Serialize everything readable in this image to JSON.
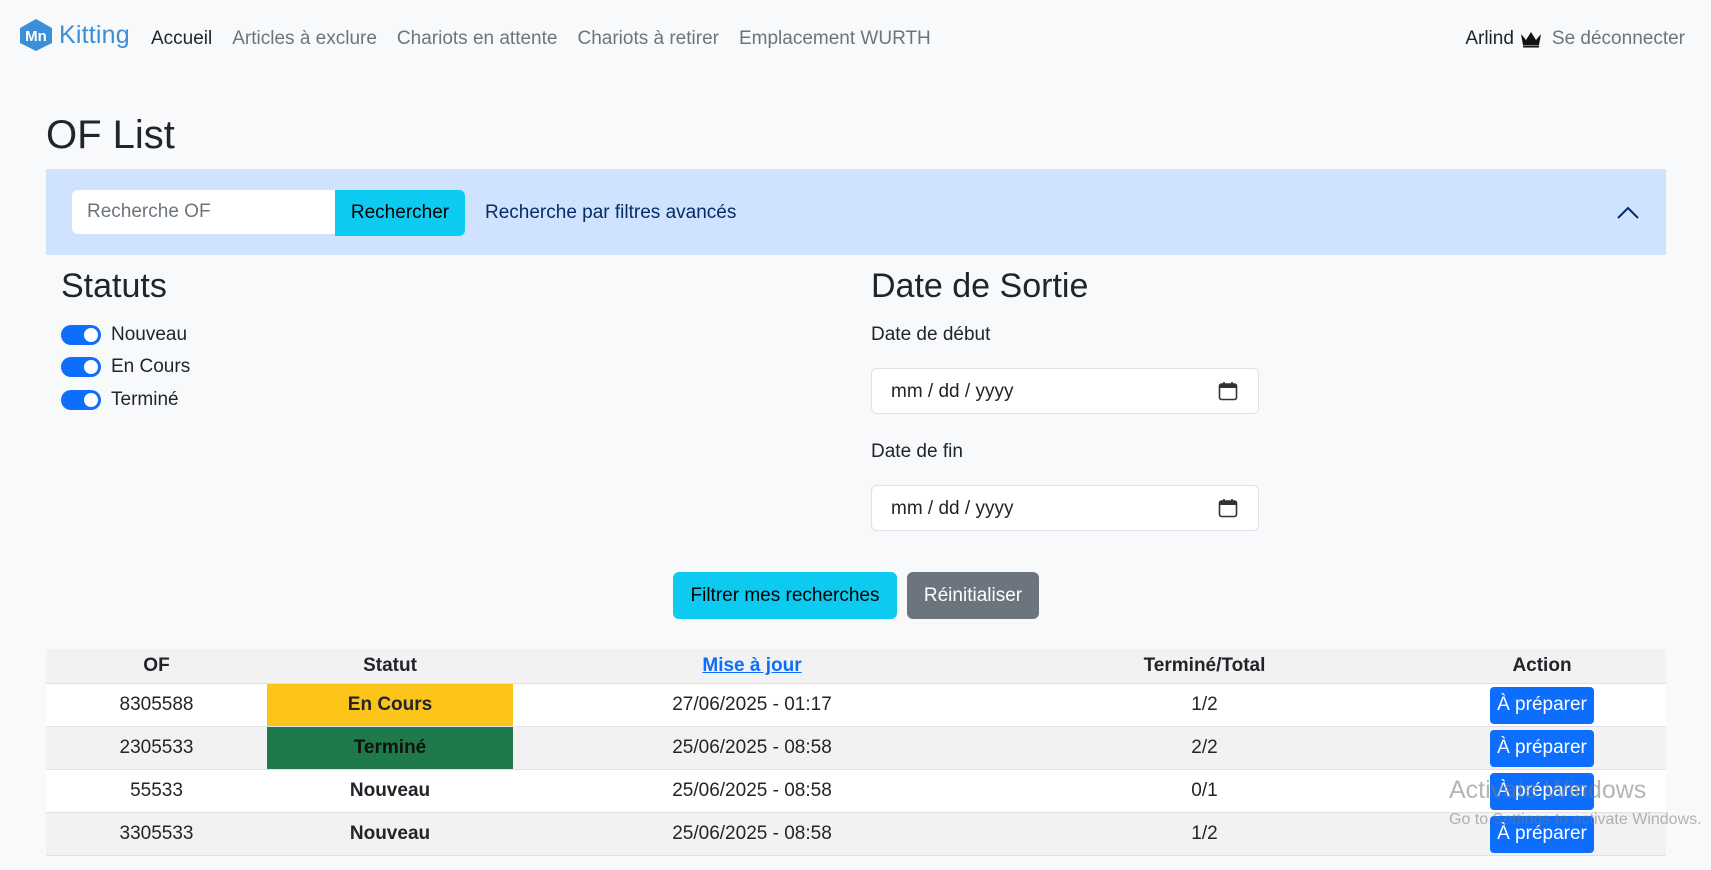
{
  "navbar": {
    "brand": "Kitting",
    "logo_icon": "mn-logo-icon",
    "links": [
      {
        "label": "Accueil",
        "active": true
      },
      {
        "label": "Articles à exclure",
        "active": false
      },
      {
        "label": "Chariots en attente",
        "active": false
      },
      {
        "label": "Chariots à retirer",
        "active": false
      },
      {
        "label": "Emplacement WURTH",
        "active": false
      }
    ],
    "user": "Arlind",
    "user_icon": "crown-icon",
    "logout": "Se déconnecter"
  },
  "page_title": "OF List",
  "search": {
    "placeholder": "Recherche OF",
    "value": "",
    "button": "Rechercher",
    "advanced_label": "Recherche par filtres avancés",
    "collapse_icon": "chevron-up-icon"
  },
  "filters": {
    "statuts_title": "Statuts",
    "statuts": [
      {
        "label": "Nouveau",
        "checked": true
      },
      {
        "label": "En Cours",
        "checked": true
      },
      {
        "label": "Terminé",
        "checked": true
      }
    ],
    "date_title": "Date de Sortie",
    "start_label": "Date de début",
    "start_value": "mm / dd / yyyy",
    "end_label": "Date de fin",
    "end_value": "mm / dd / yyyy",
    "calendar_icon": "calendar-icon",
    "filter_button": "Filtrer mes recherches",
    "reset_button": "Réinitialiser"
  },
  "table": {
    "headers": [
      "OF",
      "Statut",
      "Mise à jour",
      "Terminé/Total",
      "Action"
    ],
    "rows": [
      {
        "of": "8305588",
        "statut": "En Cours",
        "maj": "27/06/2025 - 01:17",
        "total": "1/2",
        "action": "À préparer"
      },
      {
        "of": "2305533",
        "statut": "Terminé",
        "maj": "25/06/2025 - 08:58",
        "total": "2/2",
        "action": "À préparer"
      },
      {
        "of": "55533",
        "statut": "Nouveau",
        "maj": "25/06/2025 - 08:58",
        "total": "0/1",
        "action": "À préparer"
      },
      {
        "of": "3305533",
        "statut": "Nouveau",
        "maj": "25/06/2025 - 08:58",
        "total": "1/2",
        "action": "À préparer"
      }
    ]
  },
  "colors": {
    "primary": "#0d6efd",
    "info": "#0dcaf0",
    "secondary": "#6c757d",
    "search_bg": "#cfe2ff",
    "en_cours": "#fcc419",
    "termine": "#1f7a4b"
  },
  "watermark": {
    "line1": "Activate Windows",
    "line2": "Go to Settings to activate Windows."
  }
}
